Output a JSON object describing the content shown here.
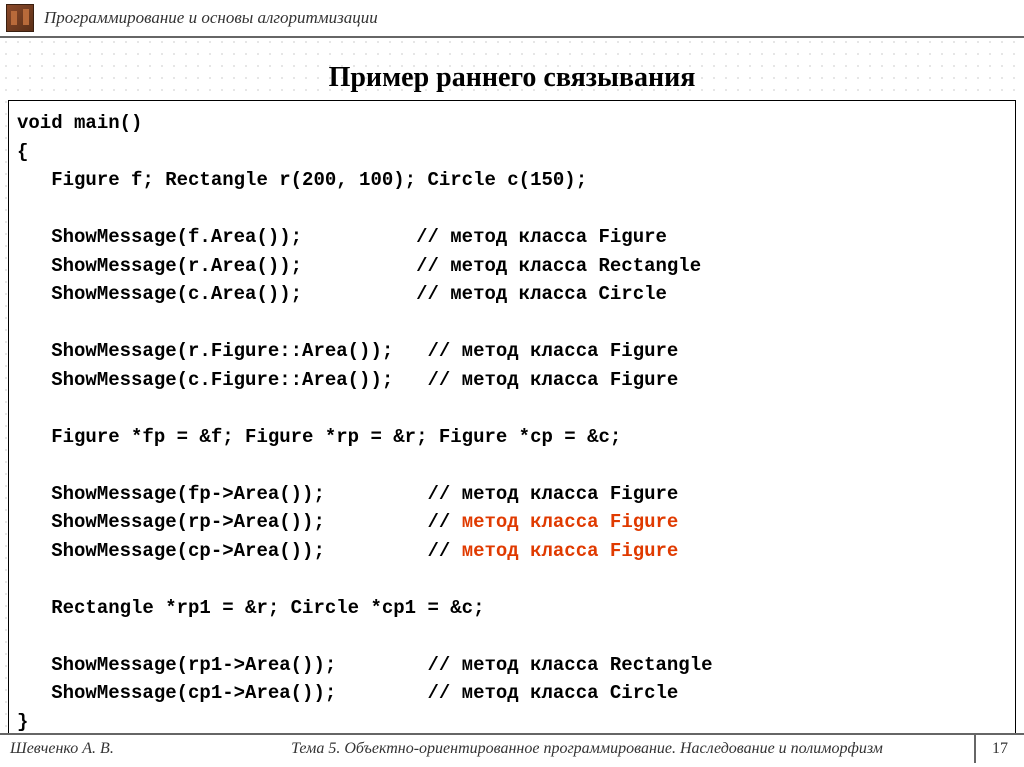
{
  "header": {
    "course_title": "Программирование и основы алгоритмизации"
  },
  "slide": {
    "title": "Пример раннего связывания"
  },
  "code": {
    "l1": "void main()",
    "l2": "{",
    "l3": "   Figure f; Rectangle r(200, 100); Circle c(150);",
    "l4": "",
    "l5": "   ShowMessage(f.Area());          // метод класса Figure",
    "l6": "   ShowMessage(r.Area());          // метод класса Rectangle",
    "l7": "   ShowMessage(c.Area());          // метод класса Circle",
    "l8": "",
    "l9": "   ShowMessage(r.Figure::Area());   // метод класса Figure",
    "l10": "   ShowMessage(c.Figure::Area());   // метод класса Figure",
    "l11": "",
    "l12": "   Figure *fp = &f; Figure *rp = &r; Figure *cp = &c;",
    "l13": "",
    "l14a": "   ShowMessage(fp->Area());         // метод класса Figure",
    "l15a": "   ShowMessage(rp->Area());         // ",
    "l15b": "метод класса Figure",
    "l16a": "   ShowMessage(cp->Area());         // ",
    "l16b": "метод класса Figure",
    "l17": "",
    "l18": "   Rectangle *rp1 = &r; Circle *cp1 = &c;",
    "l19": "",
    "l20": "   ShowMessage(rp1->Area());        // метод класса Rectangle",
    "l21": "   ShowMessage(cp1->Area());        // метод класса Circle",
    "l22": "}"
  },
  "footer": {
    "author": "Шевченко А. В.",
    "topic": "Тема 5. Объектно-ориентированное программирование. Наследование и полиморфизм",
    "page": "17"
  }
}
